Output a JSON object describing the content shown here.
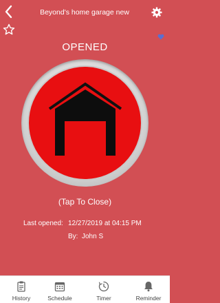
{
  "header": {
    "title": "Beyond's home garage new",
    "back_icon": "chevron-left-icon",
    "settings_icon": "gear-icon"
  },
  "favorite_icon": "star-icon",
  "heart_icon": "heart-icon",
  "door": {
    "status": "OPENED",
    "action_hint": "(Tap To Close)",
    "last_opened_label": "Last opened:",
    "last_opened_value": "12/27/2019 at 04:15 PM",
    "by_label": "By:",
    "by_value": "John S"
  },
  "colors": {
    "background": "#d24f54",
    "button_red": "#e80f11",
    "heart": "#5b6fd1"
  },
  "tabs": [
    {
      "label": "History",
      "icon": "clipboard-icon"
    },
    {
      "label": "Schedule",
      "icon": "calendar-icon"
    },
    {
      "label": "Timer",
      "icon": "timer-icon"
    },
    {
      "label": "Reminder",
      "icon": "bell-icon"
    }
  ]
}
